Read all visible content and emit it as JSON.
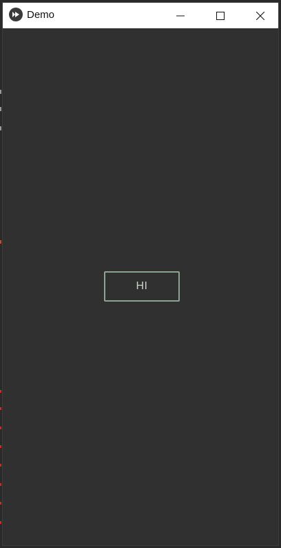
{
  "window": {
    "title": "Demo"
  },
  "main": {
    "button_label": "HI"
  },
  "colors": {
    "background": "#303030",
    "button_border": "#8fa393",
    "button_text": "#c9d3cc",
    "titlebar": "#ffffff"
  },
  "icons": {
    "app": "kivy-logo-icon",
    "minimize": "minimize-icon",
    "maximize": "maximize-icon",
    "close": "close-icon"
  }
}
